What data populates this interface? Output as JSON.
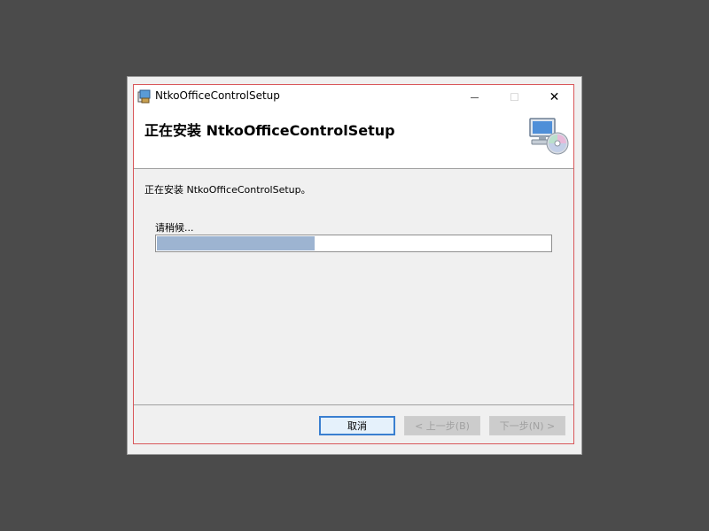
{
  "window": {
    "title": "NtkoOfficeControlSetup",
    "minimize_glyph": "—",
    "maximize_glyph": "☐",
    "close_glyph": "✕"
  },
  "header": {
    "title": "正在安装 NtkoOfficeControlSetup",
    "image_icon": "computer-with-disc-icon"
  },
  "body": {
    "status_text": "正在安装 NtkoOfficeControlSetup。",
    "wait_text": "请稍候...",
    "progress_fraction": 0.4
  },
  "buttons": {
    "cancel_label": "取消",
    "back_label": "< 上一步(B)",
    "next_label": "下一步(N) >"
  },
  "colors": {
    "progress_fill": "#9db4d1",
    "window_border": "#d9575a",
    "focus_border": "#3a7fd0"
  }
}
